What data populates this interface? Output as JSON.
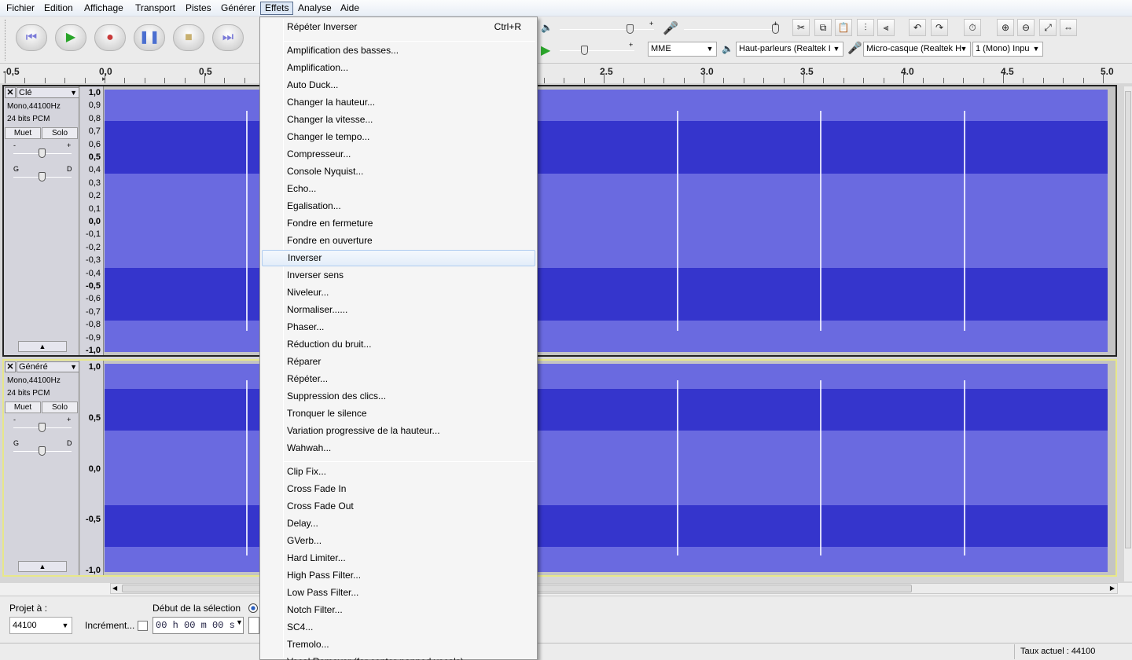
{
  "menubar": {
    "items": [
      "Fichier",
      "Edition",
      "Affichage",
      "Transport",
      "Pistes",
      "Générer",
      "Effets",
      "Analyse",
      "Aide"
    ],
    "active_index": 6
  },
  "transport": {
    "buttons": [
      {
        "name": "skip-start",
        "glyph": "⏮"
      },
      {
        "name": "play",
        "glyph": "▶"
      },
      {
        "name": "record",
        "glyph": "●"
      },
      {
        "name": "pause",
        "glyph": "❚❚"
      },
      {
        "name": "stop",
        "glyph": "■"
      },
      {
        "name": "skip-end",
        "glyph": "⏭"
      }
    ]
  },
  "devices": {
    "host": "MME",
    "output": "Haut-parleurs (Realtek I",
    "input": "Micro-casque (Realtek H",
    "channels": "1 (Mono) Inpu"
  },
  "meter": {
    "plus": "+",
    "minus": "-"
  },
  "ruler": {
    "left_labels": [
      "-0,5",
      "0,0",
      "0,5"
    ],
    "right_labels": [
      "2.5",
      "3.0",
      "3.5",
      "4.0",
      "4.5",
      "5.0"
    ]
  },
  "tracks": [
    {
      "name": "Clé",
      "info": [
        "Mono,44100Hz",
        "24 bits PCM"
      ],
      "mute": "Muet",
      "solo": "Solo",
      "gain_minus": "-",
      "gain_plus": "+",
      "pan_left": "G",
      "pan_right": "D",
      "scale": [
        "1,0",
        "0,9",
        "0,8",
        "0,7",
        "0,6",
        "0,5",
        "0,4",
        "0,3",
        "0,2",
        "0,1",
        "0,0",
        "-0,1",
        "-0,2",
        "-0,3",
        "-0,4",
        "-0,5",
        "-0,6",
        "-0,7",
        "-0,8",
        "-0,9",
        "-1,0"
      ]
    },
    {
      "name": "Généré",
      "info": [
        "Mono,44100Hz",
        "24 bits PCM"
      ],
      "mute": "Muet",
      "solo": "Solo",
      "gain_minus": "-",
      "gain_plus": "+",
      "pan_left": "G",
      "pan_right": "D",
      "scale": [
        "1,0",
        "0,5",
        "0,0",
        "-0,5",
        "-1,0"
      ]
    }
  ],
  "selection": {
    "project_rate_label": "Projet à :",
    "project_rate": "44100",
    "snap_label": "Incrément...",
    "start_label": "Début de la sélection",
    "time_value": "00 h 00 m 00 s"
  },
  "status": {
    "rate": "Taux actuel : 44100"
  },
  "effects_menu": {
    "repeat": {
      "label": "Répéter Inverser",
      "shortcut": "Ctrl+R"
    },
    "builtin": [
      "Amplification des basses...",
      "Amplification...",
      "Auto Duck...",
      "Changer la hauteur...",
      "Changer la vitesse...",
      "Changer le tempo...",
      "Compresseur...",
      "Console Nyquist...",
      "Echo...",
      "Egalisation...",
      "Fondre en fermeture",
      "Fondre en ouverture",
      "Inverser",
      "Inverser sens",
      "Niveleur...",
      "Normaliser......",
      "Phaser...",
      "Réduction du bruit...",
      "Réparer",
      "Répéter...",
      "Suppression des clics...",
      "Tronquer le silence",
      "Variation progressive de la hauteur...",
      "Wahwah..."
    ],
    "highlighted": "Inverser",
    "plugins": [
      "Clip Fix...",
      "Cross Fade In",
      "Cross Fade Out",
      "Delay...",
      "GVerb...",
      "Hard Limiter...",
      "High Pass Filter...",
      "Low Pass Filter...",
      "Notch Filter...",
      "SC4...",
      "Tremolo...",
      "Vocal Remover (for center-panned vocals)..."
    ]
  }
}
